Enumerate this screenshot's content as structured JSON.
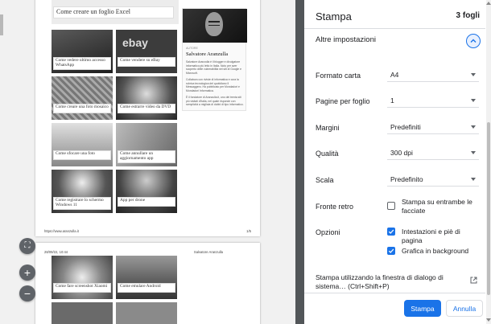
{
  "preview": {
    "page1": {
      "top_caption": "Come creare un foglio Excel",
      "thumbs": [
        {
          "caption": "Come vedere ultimo accesso WhatsApp"
        },
        {
          "caption": "Come vendere su eBay",
          "image_text": "ebay"
        },
        {
          "caption": "Come creare una foto mosaico"
        },
        {
          "caption": "Come estrarre video da DVD"
        },
        {
          "caption": "Come sfocare una foto"
        },
        {
          "caption": "Come annullare un aggiornamento app"
        },
        {
          "caption": "Come registrare lo schermo Windows 11"
        },
        {
          "caption": "App per drone"
        }
      ],
      "author": {
        "kicker": "AUTORE",
        "name": "Salvatore Aranzulla",
        "bio": [
          "Salvatore Aranzulla è il blogger e divulgatore informatico più letto in Italia. Noto per aver scoperto delle vulnerabilità nei siti di Google e Microsoft.",
          "Collabora con riviste di informatica e cura la rubrica tecnologica del quotidiano Il Messaggero. Ha pubblicato per Mondadori e Mondadori Informatica.",
          "È il fondatore di Aranzulla.it, uno dei trenta siti più visitati d'Italia, nel quale risponde con semplicità a migliaia di dubbi di tipo informatico."
        ]
      },
      "footer_left": "https://www.aranzulla.it",
      "footer_right": "1/5"
    },
    "page2": {
      "header_left": "28/09/22, 10:44",
      "header_right": "Salvatore Aranzulla",
      "thumbs": [
        {
          "caption": "Come fare screenshot Xiaomi"
        },
        {
          "caption": "Come emulare Android"
        }
      ]
    },
    "zoom": {
      "fit": "⛶",
      "plus": "+",
      "minus": "−"
    }
  },
  "panel": {
    "title": "Stampa",
    "sheets": "3 fogli",
    "more_settings": "Altre impostazioni",
    "rows": [
      {
        "key": "paper",
        "label": "Formato carta",
        "value": "A4"
      },
      {
        "key": "pages_per_sheet",
        "label": "Pagine per foglio",
        "value": "1"
      },
      {
        "key": "margins",
        "label": "Margini",
        "value": "Predefiniti"
      },
      {
        "key": "quality",
        "label": "Qualità",
        "value": "300 dpi"
      },
      {
        "key": "scale",
        "label": "Scala",
        "value": "Predefinito"
      }
    ],
    "duplex": {
      "label": "Fronte retro",
      "option": "Stampa su entrambe le facciate",
      "checked": false
    },
    "options": {
      "label": "Opzioni",
      "items": [
        {
          "label": "Intestazioni e piè di pagina",
          "checked": true
        },
        {
          "label": "Grafica in background",
          "checked": true
        }
      ]
    },
    "system_dialog": "Stampa utilizzando la finestra di dialogo di sistema… (Ctrl+Shift+P)",
    "print_button": "Stampa",
    "cancel_button": "Annulla",
    "accent": "#1a73e8"
  }
}
